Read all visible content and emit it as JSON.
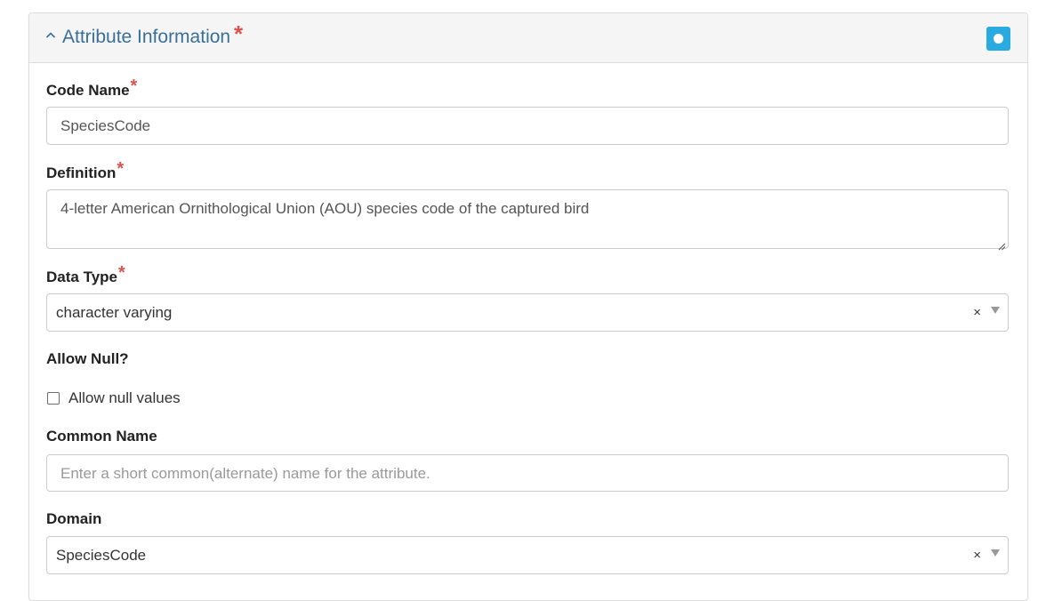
{
  "panel": {
    "title": "Attribute Information",
    "title_required_mark": "*",
    "collapse_icon": "chevron-up-icon",
    "toggle_icon": "circle-toggle-icon",
    "accent_color": "#3a6f98",
    "toggle_color": "#29abe2",
    "required_color": "#d9534f"
  },
  "fields": {
    "code_name": {
      "label": "Code Name",
      "required_mark": "*",
      "value": "SpeciesCode"
    },
    "definition": {
      "label": "Definition",
      "required_mark": "*",
      "value": "4-letter American Ornithological Union (AOU) species code of the captured bird"
    },
    "data_type": {
      "label": "Data Type",
      "required_mark": "*",
      "selected": "character varying",
      "clear_symbol": "×"
    },
    "allow_null": {
      "label": "Allow Null?",
      "checkbox_label": "Allow null values",
      "checked": false
    },
    "common_name": {
      "label": "Common Name",
      "value": "",
      "placeholder": "Enter a short common(alternate) name for the attribute."
    },
    "domain": {
      "label": "Domain",
      "selected": "SpeciesCode",
      "clear_symbol": "×"
    }
  }
}
